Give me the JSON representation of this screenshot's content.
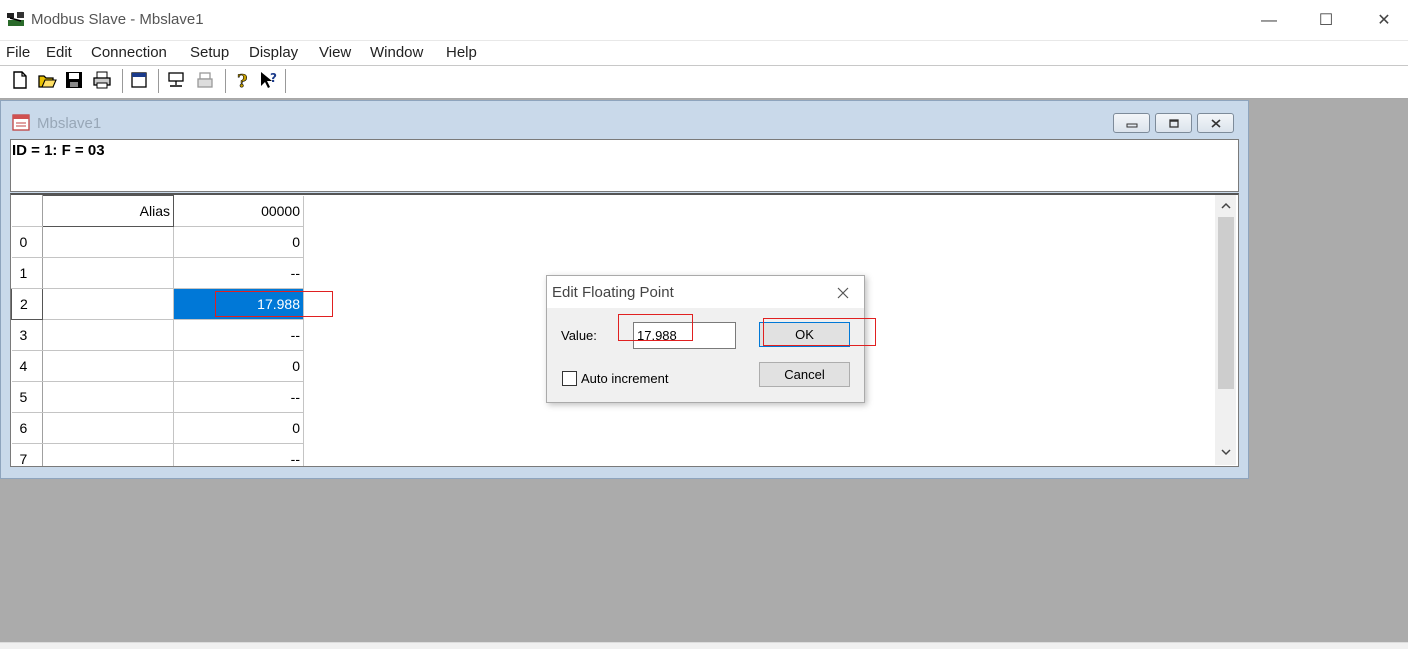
{
  "app": {
    "title": "Modbus Slave - Mbslave1",
    "minimize": "—",
    "maximize": "☐",
    "close": "✕"
  },
  "menu": [
    "File",
    "Edit",
    "Connection",
    "Setup",
    "Display",
    "View",
    "Window",
    "Help"
  ],
  "toolbar": {
    "icons": [
      "new-icon",
      "open-icon",
      "save-icon",
      "print-icon",
      "window-icon",
      "connect-icon",
      "disconnect-icon",
      "help-icon",
      "context-help-icon"
    ]
  },
  "child_window": {
    "title": "Mbslave1",
    "info": "ID = 1: F = 03",
    "grid": {
      "alias_header": "Alias",
      "column_header": "00000",
      "rows": [
        {
          "index": "0",
          "alias": "",
          "value": "0"
        },
        {
          "index": "1",
          "alias": "",
          "value": "--"
        },
        {
          "index": "2",
          "alias": "",
          "value": "17.988",
          "selected": true
        },
        {
          "index": "3",
          "alias": "",
          "value": "--"
        },
        {
          "index": "4",
          "alias": "",
          "value": "0"
        },
        {
          "index": "5",
          "alias": "",
          "value": "--"
        },
        {
          "index": "6",
          "alias": "",
          "value": "0"
        },
        {
          "index": "7",
          "alias": "",
          "value": "--"
        }
      ]
    }
  },
  "dialog": {
    "title": "Edit Floating Point",
    "value_label": "Value:",
    "value": "17.988",
    "auto_increment_label": "Auto increment",
    "auto_increment_checked": false,
    "ok_label": "OK",
    "cancel_label": "Cancel"
  },
  "colors": {
    "selection": "#0078d7",
    "annotation": "#e02020",
    "mdi_background": "#ababab"
  }
}
